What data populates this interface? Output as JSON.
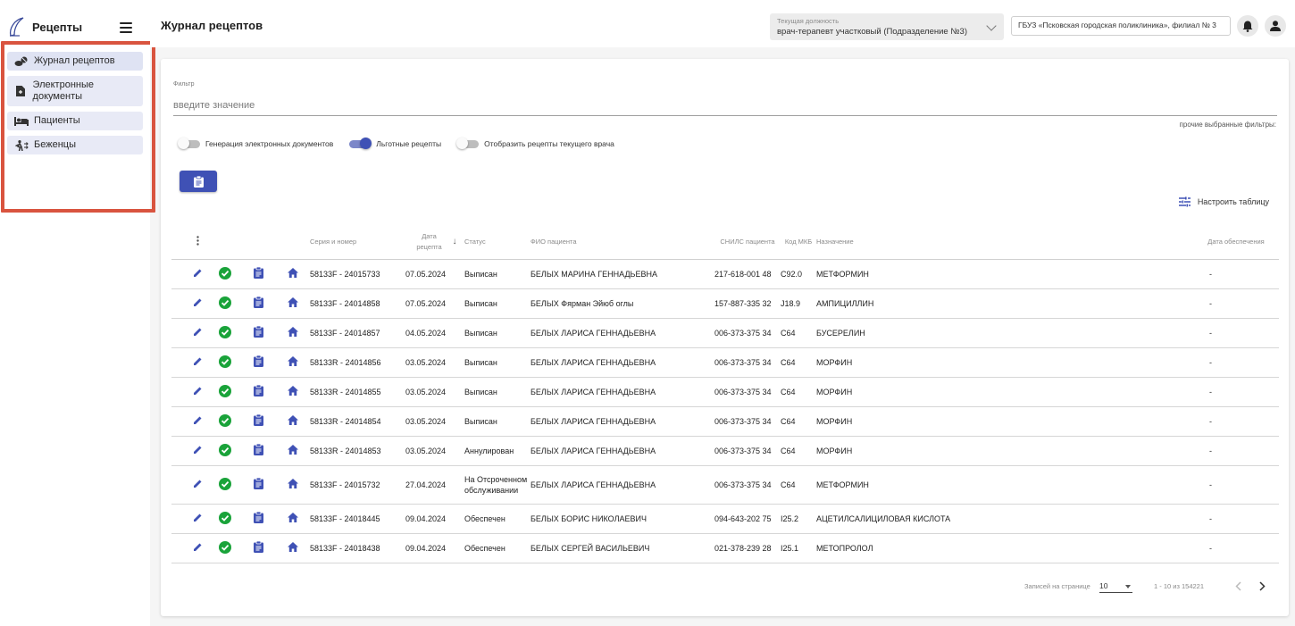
{
  "app": {
    "title": "Рецепты",
    "page_title": "Журнал рецептов"
  },
  "sidebar": {
    "items": [
      {
        "label": "Журнал рецептов",
        "icon": "pills-icon"
      },
      {
        "label": "Электронные документы",
        "icon": "document-icon"
      },
      {
        "label": "Пациенты",
        "icon": "bed-icon"
      },
      {
        "label": "Беженцы",
        "icon": "refugee-icon"
      }
    ]
  },
  "header": {
    "position_caption": "Текущая должность",
    "position_value": "врач-терапевт участковый (Подразделение №3)",
    "organization": "ГБУЗ «Псковская городская поликлиника», филиал № 3"
  },
  "filter": {
    "caption": "Фильтр",
    "placeholder": "введите значение",
    "other_filters": "прочие выбранные фильтры:"
  },
  "toggles": [
    {
      "label": "Генерация электронных документов",
      "on": false
    },
    {
      "label": "Льготные рецепты",
      "on": true
    },
    {
      "label": "Отобразить рецепты текущего врача",
      "on": false
    }
  ],
  "configure_table": "Настроить таблицу",
  "table": {
    "headers": {
      "series": "Серия и номер",
      "date": "Дата рецепта",
      "status": "Статус",
      "patient": "ФИО пациента",
      "snils": "СНИЛС пациента",
      "mkb": "Код МКБ",
      "purpose": "Назначение",
      "supply": "Дата обеспечения"
    },
    "rows": [
      {
        "series": "58133F - 24015733",
        "date": "07.05.2024",
        "status": "Выписан",
        "patient": "БЕЛЫХ МАРИНА ГЕННАДЬЕВНА",
        "snils": "217-618-001 48",
        "mkb": "C92.0",
        "purpose": "МЕТФОРМИН",
        "supply": "-"
      },
      {
        "series": "58133F - 24014858",
        "date": "07.05.2024",
        "status": "Выписан",
        "patient": "БЕЛЫХ Фярман Эйюб оглы",
        "snils": "157-887-335 32",
        "mkb": "J18.9",
        "purpose": "АМПИЦИЛЛИН",
        "supply": "-"
      },
      {
        "series": "58133F - 24014857",
        "date": "04.05.2024",
        "status": "Выписан",
        "patient": "БЕЛЫХ ЛАРИСА ГЕННАДЬЕВНА",
        "snils": "006-373-375 34",
        "mkb": "C64",
        "purpose": "БУСЕРЕЛИН",
        "supply": "-"
      },
      {
        "series": "58133R - 24014856",
        "date": "03.05.2024",
        "status": "Выписан",
        "patient": "БЕЛЫХ ЛАРИСА ГЕННАДЬЕВНА",
        "snils": "006-373-375 34",
        "mkb": "C64",
        "purpose": "МОРФИН",
        "supply": "-"
      },
      {
        "series": "58133R - 24014855",
        "date": "03.05.2024",
        "status": "Выписан",
        "patient": "БЕЛЫХ ЛАРИСА ГЕННАДЬЕВНА",
        "snils": "006-373-375 34",
        "mkb": "C64",
        "purpose": "МОРФИН",
        "supply": "-"
      },
      {
        "series": "58133R - 24014854",
        "date": "03.05.2024",
        "status": "Выписан",
        "patient": "БЕЛЫХ ЛАРИСА ГЕННАДЬЕВНА",
        "snils": "006-373-375 34",
        "mkb": "C64",
        "purpose": "МОРФИН",
        "supply": "-"
      },
      {
        "series": "58133R - 24014853",
        "date": "03.05.2024",
        "status": "Аннулирован",
        "patient": "БЕЛЫХ ЛАРИСА ГЕННАДЬЕВНА",
        "snils": "006-373-375 34",
        "mkb": "C64",
        "purpose": "МОРФИН",
        "supply": "-"
      },
      {
        "series": "58133F - 24015732",
        "date": "27.04.2024",
        "status": "На Отсроченном обслуживании",
        "patient": "БЕЛЫХ ЛАРИСА ГЕННАДЬЕВНА",
        "snils": "006-373-375 34",
        "mkb": "C64",
        "purpose": "МЕТФОРМИН",
        "supply": "-",
        "tall": true
      },
      {
        "series": "58133F - 24018445",
        "date": "09.04.2024",
        "status": "Обеспечен",
        "patient": "БЕЛЫХ БОРИС НИКОЛАЕВИЧ",
        "snils": "094-643-202 75",
        "mkb": "I25.2",
        "purpose": "АЦЕТИЛСАЛИЦИЛОВАЯ КИСЛОТА",
        "supply": "-"
      },
      {
        "series": "58133F - 24018438",
        "date": "09.04.2024",
        "status": "Обеспечен",
        "patient": "БЕЛЫХ СЕРГЕЙ ВАСИЛЬЕВИЧ",
        "snils": "021-378-239 28",
        "mkb": "I25.1",
        "purpose": "МЕТОПРОЛОЛ",
        "supply": "-"
      }
    ]
  },
  "pagination": {
    "per_page_label": "Записей на странице",
    "per_page": "10",
    "range": "1 - 10 из 154221"
  },
  "colors": {
    "primary": "#3f51b5",
    "success": "#1aa33a",
    "highlight": "#d9543f"
  }
}
